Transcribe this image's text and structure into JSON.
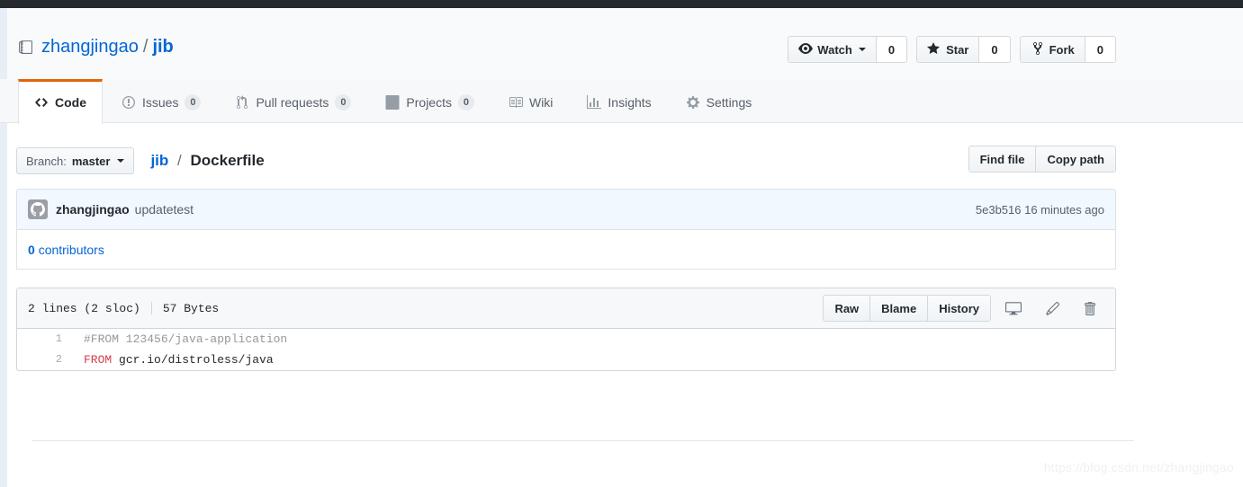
{
  "repo": {
    "icon": "repo-book-icon",
    "owner": "zhangjingao",
    "separator": "/",
    "name": "jib"
  },
  "social": [
    {
      "id": "watch",
      "icon": "eye-icon",
      "label": "Watch",
      "has_caret": true,
      "count": "0"
    },
    {
      "id": "star",
      "icon": "star-icon",
      "label": "Star",
      "has_caret": false,
      "count": "0"
    },
    {
      "id": "fork",
      "icon": "fork-icon",
      "label": "Fork",
      "has_caret": false,
      "count": "0"
    }
  ],
  "nav": {
    "active": "Code",
    "items": [
      {
        "id": "code",
        "icon": "code-icon",
        "label": "Code",
        "badge": null
      },
      {
        "id": "issues",
        "icon": "issue-opened-icon",
        "label": "Issues",
        "badge": "0"
      },
      {
        "id": "pull-requests",
        "icon": "git-pull-request-icon",
        "label": "Pull requests",
        "badge": "0"
      },
      {
        "id": "projects",
        "icon": "project-board-icon",
        "label": "Projects",
        "badge": "0"
      },
      {
        "id": "wiki",
        "icon": "book-icon",
        "label": "Wiki",
        "badge": null
      },
      {
        "id": "insights",
        "icon": "graph-bar-icon",
        "label": "Insights",
        "badge": null
      },
      {
        "id": "settings",
        "icon": "gear-icon",
        "label": "Settings",
        "badge": null
      }
    ]
  },
  "file_nav": {
    "branch_prefix": "Branch:",
    "branch_name": "master",
    "breadcrumb_root": "jib",
    "breadcrumb_sep": "/",
    "breadcrumb_current": "Dockerfile",
    "find_file_label": "Find file",
    "copy_path_label": "Copy path"
  },
  "commit": {
    "avatar_icon": "github-mark-avatar",
    "author": "zhangjingao",
    "message": "updatetest",
    "sha": "5e3b516",
    "time": "16 minutes ago",
    "meta": "5e3b516 16 minutes ago"
  },
  "contributors": {
    "count": "0",
    "label": "contributors"
  },
  "file": {
    "lines_info": "2 lines (2 sloc)",
    "size": "57 Bytes",
    "buttons": [
      {
        "id": "raw",
        "label": "Raw"
      },
      {
        "id": "blame",
        "label": "Blame"
      },
      {
        "id": "history",
        "label": "History"
      }
    ],
    "icon_buttons": [
      {
        "id": "open-desktop",
        "icon": "desktop-download-icon"
      },
      {
        "id": "edit-file",
        "icon": "pencil-icon"
      },
      {
        "id": "delete-file",
        "icon": "trash-icon"
      }
    ],
    "code": [
      {
        "number": "1",
        "tokens": [
          {
            "type": "comment",
            "text": "#FROM 123456/java-application"
          }
        ]
      },
      {
        "number": "2",
        "tokens": [
          {
            "type": "keyword",
            "text": "FROM"
          },
          {
            "type": "plain",
            "text": " gcr.io/distroless/java"
          }
        ]
      }
    ]
  },
  "watermark": "https://blog.csdn.net/zhangjingao",
  "colors": {
    "accent_orange": "#e36209",
    "link_blue": "#0366d6",
    "keyword_red": "#d73a49",
    "comment_grey": "#969896",
    "header_dark": "#24292e",
    "commit_bg": "#f1f8ff"
  }
}
